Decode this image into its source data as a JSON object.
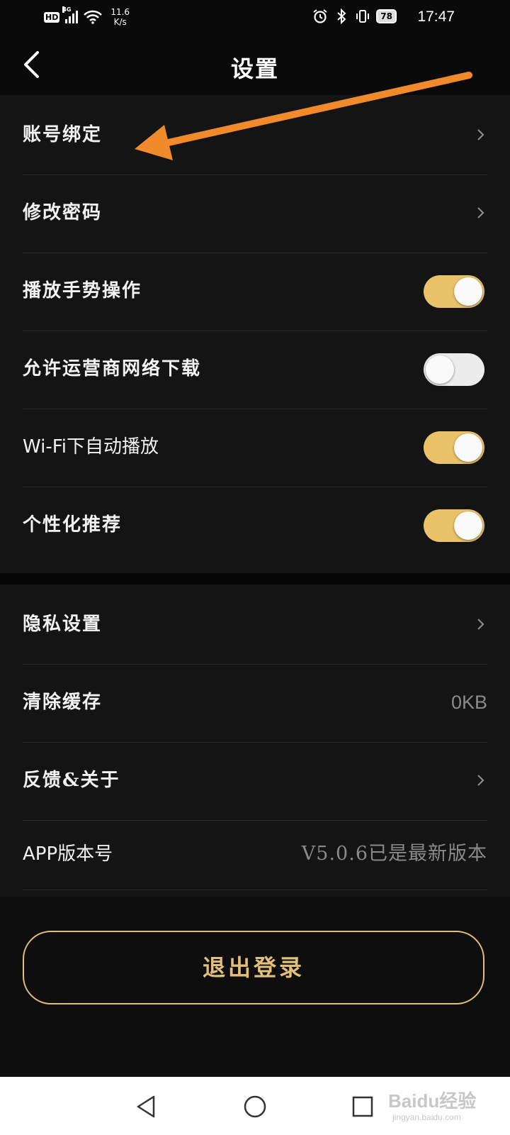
{
  "status_bar": {
    "hd": "HD",
    "network": "4G",
    "speed_value": "11.6",
    "speed_unit": "K/s",
    "battery": "78",
    "time": "17:47"
  },
  "header": {
    "title": "设置"
  },
  "group1": [
    {
      "label": "账号绑定",
      "type": "link"
    },
    {
      "label": "修改密码",
      "type": "link"
    },
    {
      "label": "播放手势操作",
      "type": "toggle",
      "on": true
    },
    {
      "label": "允许运营商网络下载",
      "type": "toggle",
      "on": false
    },
    {
      "label": "Wi-Fi下自动播放",
      "type": "toggle",
      "on": true
    },
    {
      "label": "个性化推荐",
      "type": "toggle",
      "on": true
    }
  ],
  "group2": [
    {
      "label": "隐私设置",
      "type": "link"
    },
    {
      "label": "清除缓存",
      "type": "value",
      "value": "0KB"
    },
    {
      "label": "反馈&关于",
      "type": "link"
    },
    {
      "label": "APP版本号",
      "type": "value",
      "value": "V5.0.6已是最新版本"
    }
  ],
  "logout_label": "退出登录",
  "watermark": {
    "text": "Baidu经验",
    "sub": "jingyan.baidu.com"
  },
  "colors": {
    "accent": "#eac26a",
    "logout": "#e3bf7c",
    "annotation_arrow": "#f08a2a",
    "background": "#141414"
  },
  "icons": {
    "back": "back-arrow-icon",
    "chevron": "chevron-right-icon",
    "nav": [
      "back-triangle-icon",
      "home-circle-icon",
      "recents-square-icon"
    ]
  }
}
